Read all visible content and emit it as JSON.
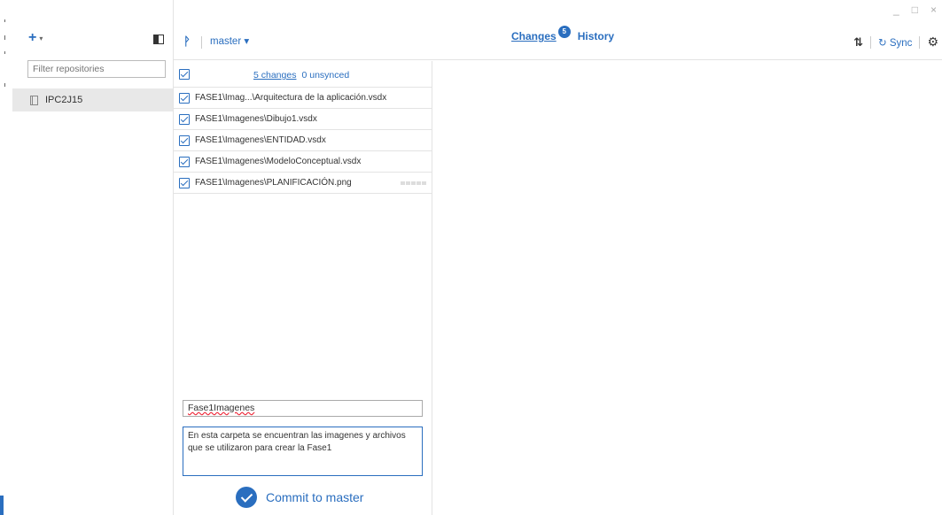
{
  "window": {
    "minimize": "_",
    "maximize": "□",
    "close": "×"
  },
  "sidebar": {
    "add_label": "+",
    "filter_placeholder": "Filter repositories",
    "repositories": [
      {
        "name": "IPC2J15"
      }
    ]
  },
  "header": {
    "branch_label": "master ▾",
    "tabs": [
      {
        "label": "Changes",
        "badge": "5"
      },
      {
        "label": "History"
      }
    ],
    "sync_label": "Sync"
  },
  "changes": {
    "count_label": "5 changes",
    "unsynced_label": "0 unsynced",
    "files": [
      {
        "path": "FASE1\\Imag...\\Arquitectura de la aplicación.vsdx"
      },
      {
        "path": "FASE1\\Imagenes\\Dibujo1.vsdx"
      },
      {
        "path": "FASE1\\Imagenes\\ENTIDAD.vsdx"
      },
      {
        "path": "FASE1\\Imagenes\\ModeloConceptual.vsdx"
      },
      {
        "path": "FASE1\\Imagenes\\PLANIFICACIÓN.png"
      }
    ]
  },
  "commit": {
    "summary": "Fase1Imagenes",
    "description": "En esta carpeta se encuentran las imagenes y archivos que se utilizaron para crear la Fase1",
    "button_label": "Commit to master"
  },
  "colors": {
    "accent": "#2a6ebf",
    "selected_bg": "#e8e8e8",
    "border": "#e3e3e3"
  }
}
